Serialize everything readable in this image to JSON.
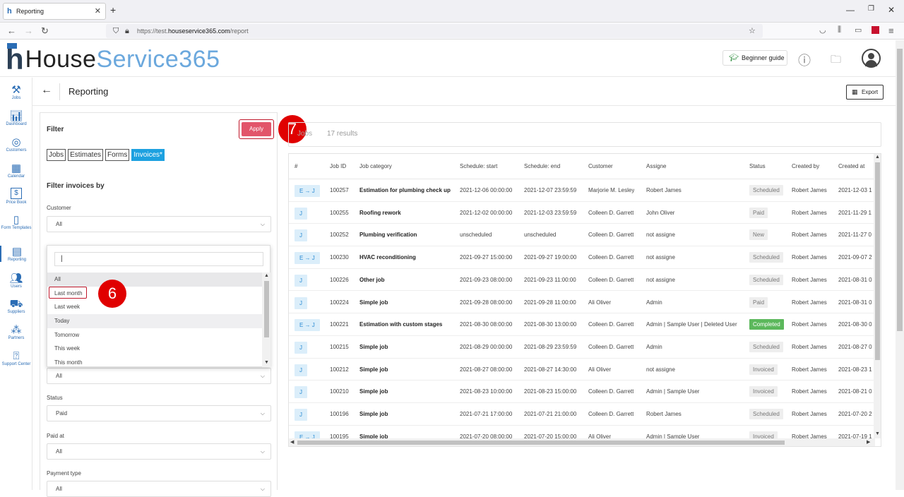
{
  "browser": {
    "tab_title": "Reporting",
    "url_prefix": "https://test.",
    "url_host": "houseservice365.com",
    "url_path": "/report"
  },
  "app": {
    "logo_part1": "House",
    "logo_part2": "Service365",
    "beginner_guide": "Beginner guide",
    "page_title": "Reporting",
    "export_label": "Export"
  },
  "sidebar": {
    "items": [
      {
        "label": "Jobs",
        "icon": "tools-icon"
      },
      {
        "label": "Dashboard",
        "icon": "chart-icon"
      },
      {
        "label": "Customers",
        "icon": "target-icon"
      },
      {
        "label": "Calendar",
        "icon": "calendar-icon"
      },
      {
        "label": "Price Book",
        "icon": "price-tag-icon"
      },
      {
        "label": "Form Templates",
        "icon": "form-icon"
      },
      {
        "label": "Reporting",
        "icon": "report-icon"
      },
      {
        "label": "Users",
        "icon": "users-icon"
      },
      {
        "label": "Suppliers",
        "icon": "truck-icon"
      },
      {
        "label": "Partners",
        "icon": "partners-icon"
      },
      {
        "label": "Support Center",
        "icon": "help-icon"
      }
    ]
  },
  "filter": {
    "title": "Filter",
    "apply": "Apply",
    "tabs": [
      "Jobs",
      "Estimates",
      "Forms",
      "Invoices*"
    ],
    "filter_by": "Filter invoices by",
    "customer_label": "Customer",
    "customer_value": "All",
    "date_value": "All",
    "status_label": "Status",
    "status_value": "Paid",
    "paid_at_label": "Paid at",
    "paid_at_value": "All",
    "payment_type_label": "Payment type",
    "payment_type_value": "All"
  },
  "dropdown": {
    "search_value": "|",
    "options": [
      "All",
      "Last month",
      "Last week",
      "Today",
      "Tomorrow",
      "This week",
      "This month"
    ]
  },
  "callouts": {
    "step6": "6",
    "step7": "7"
  },
  "results": {
    "tab": "Jobs",
    "count": "17 results"
  },
  "table": {
    "columns": [
      "#",
      "Job ID",
      "Job category",
      "Schedule: start",
      "Schedule: end",
      "Customer",
      "Assigne",
      "Status",
      "Created by",
      "Created at"
    ],
    "rows": [
      {
        "type": "E → J",
        "id": "100257",
        "cat": "Estimation for plumbing check up",
        "start": "2021-12-06 00:00:00",
        "end": "2021-12-07 23:59:59",
        "customer": "Marjorie M. Lesley",
        "assignee": "Robert James",
        "status": "Scheduled",
        "created_by": "Robert James",
        "created_at": "2021-12-03 1"
      },
      {
        "type": "J",
        "id": "100255",
        "cat": "Roofing rework",
        "start": "2021-12-02 00:00:00",
        "end": "2021-12-03 23:59:59",
        "customer": "Colleen D. Garrett",
        "assignee": "John Oliver",
        "status": "Paid",
        "created_by": "Robert James",
        "created_at": "2021-11-29 1"
      },
      {
        "type": "J",
        "id": "100252",
        "cat": "Plumbing verification",
        "start": "unscheduled",
        "end": "unscheduled",
        "customer": "Colleen D. Garrett",
        "assignee": "not assigne",
        "status": "New",
        "created_by": "Robert James",
        "created_at": "2021-11-27 0"
      },
      {
        "type": "E → J",
        "id": "100230",
        "cat": "HVAC reconditioning",
        "start": "2021-09-27 15:00:00",
        "end": "2021-09-27 19:00:00",
        "customer": "Colleen D. Garrett",
        "assignee": "not assigne",
        "status": "Scheduled",
        "created_by": "Robert James",
        "created_at": "2021-09-07 2"
      },
      {
        "type": "J",
        "id": "100226",
        "cat": "Other job",
        "start": "2021-09-23 08:00:00",
        "end": "2021-09-23 11:00:00",
        "customer": "Colleen D. Garrett",
        "assignee": "not assigne",
        "status": "Scheduled",
        "created_by": "Robert James",
        "created_at": "2021-08-31 0"
      },
      {
        "type": "J",
        "id": "100224",
        "cat": "Simple job",
        "start": "2021-09-28 08:00:00",
        "end": "2021-09-28 11:00:00",
        "customer": "Ali Oliver",
        "assignee": "Admin",
        "status": "Paid",
        "created_by": "Robert James",
        "created_at": "2021-08-31 0"
      },
      {
        "type": "E → J",
        "id": "100221",
        "cat": "Estimation with custom stages",
        "start": "2021-08-30 08:00:00",
        "end": "2021-08-30 13:00:00",
        "customer": "Colleen D. Garrett",
        "assignee": "Admin | Sample User | Deleted User",
        "status": "Completed",
        "created_by": "Robert James",
        "created_at": "2021-08-30 0"
      },
      {
        "type": "J",
        "id": "100215",
        "cat": "Simple job",
        "start": "2021-08-29 00:00:00",
        "end": "2021-08-29 23:59:59",
        "customer": "Colleen D. Garrett",
        "assignee": "Admin",
        "status": "Scheduled",
        "created_by": "Robert James",
        "created_at": "2021-08-27 0"
      },
      {
        "type": "J",
        "id": "100212",
        "cat": "Simple job",
        "start": "2021-08-27 08:00:00",
        "end": "2021-08-27 14:30:00",
        "customer": "Ali Oliver",
        "assignee": "not assigne",
        "status": "Invoiced",
        "created_by": "Robert James",
        "created_at": "2021-08-23 1"
      },
      {
        "type": "J",
        "id": "100210",
        "cat": "Simple job",
        "start": "2021-08-23 10:00:00",
        "end": "2021-08-23 15:00:00",
        "customer": "Colleen D. Garrett",
        "assignee": "Admin | Sample User",
        "status": "Invoiced",
        "created_by": "Robert James",
        "created_at": "2021-08-21 0"
      },
      {
        "type": "J",
        "id": "100196",
        "cat": "Simple job",
        "start": "2021-07-21 17:00:00",
        "end": "2021-07-21 21:00:00",
        "customer": "Colleen D. Garrett",
        "assignee": "Robert James",
        "status": "Scheduled",
        "created_by": "Robert James",
        "created_at": "2021-07-20 2"
      },
      {
        "type": "E → J",
        "id": "100195",
        "cat": "Simple job",
        "start": "2021-07-20 08:00:00",
        "end": "2021-07-20 15:00:00",
        "customer": "Ali Oliver",
        "assignee": "Admin | Sample User",
        "status": "Invoiced",
        "created_by": "Robert James",
        "created_at": "2021-07-19 1"
      }
    ]
  }
}
